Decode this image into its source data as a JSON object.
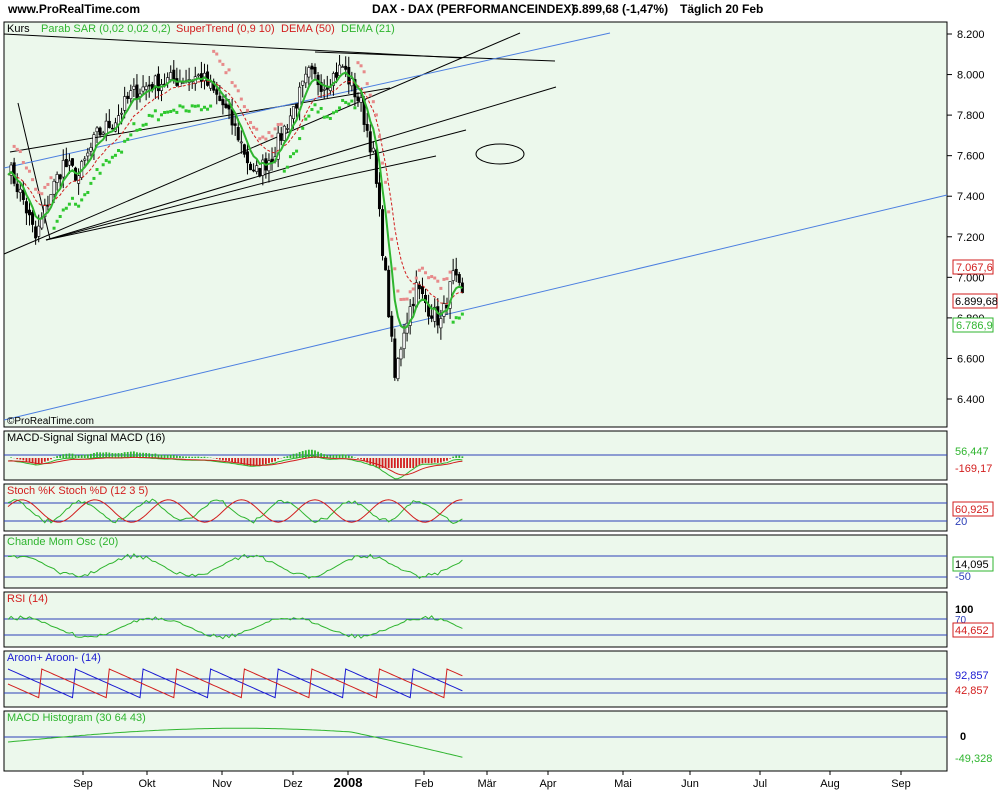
{
  "header": {
    "site": "www.ProRealTime.com",
    "instrument": "DAX - DAX (PERFORMANCEINDEX)",
    "quote": "6.899,68 (-1,47%)",
    "period": "Täglich  20 Feb"
  },
  "colors": {
    "panel_bg": "#ecf8ec",
    "up": "#2fb52f",
    "down": "#d21e1e",
    "sar": "#2fc82f",
    "supertrend": "#e78a8a",
    "blue": "#1a1ad2",
    "trend_blue": "#4c7fe0",
    "ref_line": "#2c3fb8"
  },
  "chart_data": [
    {
      "type": "line",
      "panel": "price",
      "title": "Kurs",
      "legend": [
        "Parab SAR (0,02 0,02 0,2)",
        "SuperTrend (0,9 10)",
        "DEMA (50)",
        "DEMA (21)"
      ],
      "ylim": [
        6250,
        8300
      ],
      "yticks": [
        6400,
        6600,
        6800,
        7000,
        7200,
        7400,
        7600,
        7800,
        8000,
        8200
      ],
      "ytick_labels": [
        "6.400",
        "6.600",
        "6.800",
        "7.000",
        "7.200",
        "7.400",
        "7.600",
        "7.800",
        "8.000",
        "8.200"
      ],
      "value_labels": [
        "7.067,6",
        "6.899,68",
        "6.786,9"
      ],
      "watermark": "©ProRealTime.com",
      "close_anchors": [
        [
          0,
          7550
        ],
        [
          5,
          7380
        ],
        [
          9,
          7190
        ],
        [
          14,
          7420
        ],
        [
          18,
          7560
        ],
        [
          23,
          7500
        ],
        [
          29,
          7700
        ],
        [
          35,
          7780
        ],
        [
          40,
          7900
        ],
        [
          46,
          7950
        ],
        [
          52,
          7970
        ],
        [
          57,
          7980
        ],
        [
          63,
          7990
        ],
        [
          70,
          7850
        ],
        [
          75,
          7700
        ],
        [
          80,
          7500
        ],
        [
          86,
          7600
        ],
        [
          92,
          7800
        ],
        [
          98,
          8000
        ],
        [
          103,
          7950
        ],
        [
          109,
          8040
        ],
        [
          115,
          7850
        ],
        [
          119,
          7600
        ],
        [
          123,
          7000
        ],
        [
          126,
          6500
        ],
        [
          129,
          6750
        ],
        [
          133,
          6950
        ],
        [
          137,
          6850
        ],
        [
          141,
          6780
        ],
        [
          145,
          7000
        ],
        [
          148,
          6900
        ]
      ],
      "candles": 149,
      "x_range_days": [
        0,
        298
      ]
    },
    {
      "type": "bar",
      "panel": "macd",
      "title": "MACD-Signal Signal MACD (16)",
      "value_labels": [
        "56,447",
        "-169,17"
      ]
    },
    {
      "type": "line",
      "panel": "stoch",
      "title": "Stoch %K Stoch %D (12 3 5)",
      "tick_labels": [
        "20"
      ],
      "value_labels": [
        "60,925"
      ]
    },
    {
      "type": "line",
      "panel": "cmo",
      "title": "Chande Mom Osc (20)",
      "tick_labels": [
        "-50"
      ],
      "value_labels": [
        "14,095"
      ]
    },
    {
      "type": "line",
      "panel": "rsi",
      "title": "RSI (14)",
      "tick_labels": [
        "100",
        "70"
      ],
      "value_labels": [
        "44,652"
      ]
    },
    {
      "type": "line",
      "panel": "aroon",
      "title": "Aroon+ Aroon- (14)",
      "value_labels": [
        "92,857",
        "42,857"
      ]
    },
    {
      "type": "line",
      "panel": "hist",
      "title": "MACD Histogram (30 64 43)",
      "tick_labels": [
        "0"
      ],
      "value_labels": [
        "-49,328"
      ]
    }
  ],
  "x_axis": {
    "labels": [
      "Sep",
      "Okt",
      "Nov",
      "Dez",
      "2008",
      "Feb",
      "Mär",
      "Apr",
      "Mai",
      "Jun",
      "Jul",
      "Aug",
      "Sep"
    ],
    "bold_label": "2008"
  }
}
